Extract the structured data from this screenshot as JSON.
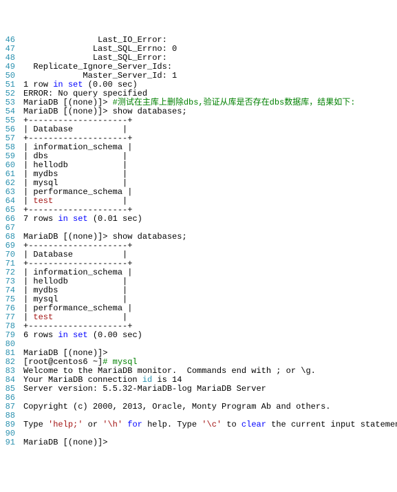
{
  "lines": [
    {
      "n": 46,
      "segs": [
        {
          "t": "               Last_IO_Error:"
        }
      ]
    },
    {
      "n": 47,
      "segs": [
        {
          "t": "              Last_SQL_Errno: 0"
        }
      ]
    },
    {
      "n": 48,
      "segs": [
        {
          "t": "              Last_SQL_Error:"
        }
      ]
    },
    {
      "n": 49,
      "segs": [
        {
          "t": "  Replicate_Ignore_Server_Ids:"
        }
      ]
    },
    {
      "n": 50,
      "segs": [
        {
          "t": "            Master_Server_Id: 1"
        }
      ]
    },
    {
      "n": 51,
      "segs": [
        {
          "t": "1 row "
        },
        {
          "t": "in",
          "c": "kw"
        },
        {
          "t": " "
        },
        {
          "t": "set",
          "c": "kw"
        },
        {
          "t": " (0.00 sec)"
        }
      ]
    },
    {
      "n": 52,
      "segs": [
        {
          "t": "ERROR: No query specified"
        }
      ]
    },
    {
      "n": 53,
      "segs": [
        {
          "t": "MariaDB [(none)]> "
        },
        {
          "t": "#测试在主库上删除dbs,验证从库是否存在dbs数据库，结果如下:",
          "c": "cm"
        }
      ]
    },
    {
      "n": 54,
      "segs": [
        {
          "t": "MariaDB [(none)]> show databases;"
        }
      ]
    },
    {
      "n": 55,
      "segs": [
        {
          "t": "+--------------------+"
        }
      ]
    },
    {
      "n": 56,
      "segs": [
        {
          "t": "| Database          |"
        }
      ]
    },
    {
      "n": 57,
      "segs": [
        {
          "t": "+--------------------+"
        }
      ]
    },
    {
      "n": 58,
      "segs": [
        {
          "t": "| information_schema |"
        }
      ]
    },
    {
      "n": 59,
      "segs": [
        {
          "t": "| dbs               |"
        }
      ]
    },
    {
      "n": 60,
      "segs": [
        {
          "t": "| hellodb           |"
        }
      ]
    },
    {
      "n": 61,
      "segs": [
        {
          "t": "| mydbs             |"
        }
      ]
    },
    {
      "n": 62,
      "segs": [
        {
          "t": "| mysql             |"
        }
      ]
    },
    {
      "n": 63,
      "segs": [
        {
          "t": "| performance_schema |"
        }
      ]
    },
    {
      "n": 64,
      "segs": [
        {
          "t": "| "
        },
        {
          "t": "test",
          "c": "str"
        },
        {
          "t": "              |"
        }
      ]
    },
    {
      "n": 65,
      "segs": [
        {
          "t": "+--------------------+"
        }
      ]
    },
    {
      "n": 66,
      "segs": [
        {
          "t": "7 rows "
        },
        {
          "t": "in",
          "c": "kw"
        },
        {
          "t": " "
        },
        {
          "t": "set",
          "c": "kw"
        },
        {
          "t": " (0.01 sec)"
        }
      ]
    },
    {
      "n": 67,
      "segs": [
        {
          "t": " "
        }
      ]
    },
    {
      "n": 68,
      "segs": [
        {
          "t": "MariaDB [(none)]> show databases;"
        }
      ]
    },
    {
      "n": 69,
      "segs": [
        {
          "t": "+--------------------+"
        }
      ]
    },
    {
      "n": 70,
      "segs": [
        {
          "t": "| Database          |"
        }
      ]
    },
    {
      "n": 71,
      "segs": [
        {
          "t": "+--------------------+"
        }
      ]
    },
    {
      "n": 72,
      "segs": [
        {
          "t": "| information_schema |"
        }
      ]
    },
    {
      "n": 73,
      "segs": [
        {
          "t": "| hellodb           |"
        }
      ]
    },
    {
      "n": 74,
      "segs": [
        {
          "t": "| mydbs             |"
        }
      ]
    },
    {
      "n": 75,
      "segs": [
        {
          "t": "| mysql             |"
        }
      ]
    },
    {
      "n": 76,
      "segs": [
        {
          "t": "| performance_schema |"
        }
      ]
    },
    {
      "n": 77,
      "segs": [
        {
          "t": "| "
        },
        {
          "t": "test",
          "c": "str"
        },
        {
          "t": "              |"
        }
      ]
    },
    {
      "n": 78,
      "segs": [
        {
          "t": "+--------------------+"
        }
      ]
    },
    {
      "n": 79,
      "segs": [
        {
          "t": "6 rows "
        },
        {
          "t": "in",
          "c": "kw"
        },
        {
          "t": " "
        },
        {
          "t": "set",
          "c": "kw"
        },
        {
          "t": " (0.00 sec)"
        }
      ]
    },
    {
      "n": 80,
      "segs": [
        {
          "t": " "
        }
      ]
    },
    {
      "n": 81,
      "segs": [
        {
          "t": "MariaDB [(none)]>"
        }
      ]
    },
    {
      "n": 82,
      "segs": [
        {
          "t": "[root@centos6 ~]"
        },
        {
          "t": "# mysql",
          "c": "cm"
        }
      ]
    },
    {
      "n": 83,
      "segs": [
        {
          "t": "Welcome to the MariaDB monitor.  Commands end with ; or \\g."
        }
      ]
    },
    {
      "n": 84,
      "segs": [
        {
          "t": "Your MariaDB connection "
        },
        {
          "t": "id",
          "c": "id"
        },
        {
          "t": " is 14"
        }
      ]
    },
    {
      "n": 85,
      "segs": [
        {
          "t": "Server version: 5.5.32-MariaDB-log MariaDB Server"
        }
      ]
    },
    {
      "n": 86,
      "segs": [
        {
          "t": " "
        }
      ]
    },
    {
      "n": 87,
      "segs": [
        {
          "t": "Copyright (c) 2000, 2013, Oracle, Monty Program Ab and others."
        }
      ]
    },
    {
      "n": 88,
      "segs": [
        {
          "t": " "
        }
      ]
    },
    {
      "n": 89,
      "segs": [
        {
          "t": "Type "
        },
        {
          "t": "'help;'",
          "c": "str"
        },
        {
          "t": " or "
        },
        {
          "t": "'\\h'",
          "c": "str"
        },
        {
          "t": " "
        },
        {
          "t": "for",
          "c": "kw"
        },
        {
          "t": " help. Type "
        },
        {
          "t": "'\\c'",
          "c": "str"
        },
        {
          "t": " to "
        },
        {
          "t": "clear",
          "c": "kw"
        },
        {
          "t": " the current input statement"
        }
      ]
    },
    {
      "n": 90,
      "segs": [
        {
          "t": " "
        }
      ]
    },
    {
      "n": 91,
      "segs": [
        {
          "t": "MariaDB [(none)]>"
        }
      ]
    }
  ]
}
